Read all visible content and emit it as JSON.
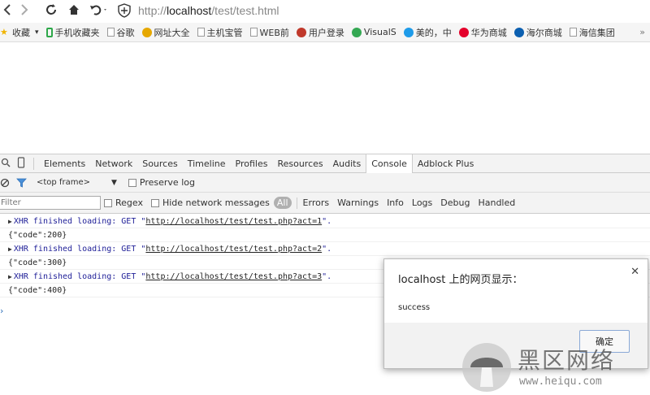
{
  "browser": {
    "url_prefix": "http://",
    "url_host": "localhost",
    "url_path": "/test/test.html"
  },
  "bookmarks": [
    {
      "label": "收藏",
      "icon": "star-icon"
    },
    {
      "label": "手机收藏夹",
      "icon": "phone-icon"
    },
    {
      "label": "谷歌",
      "icon": "page-icon"
    },
    {
      "label": "网址大全",
      "icon": "sogou-icon"
    },
    {
      "label": "主机宝管",
      "icon": "page-icon"
    },
    {
      "label": "WEB前",
      "icon": "page-icon"
    },
    {
      "label": "用户登录",
      "icon": "site-icon"
    },
    {
      "label": "VisualS",
      "icon": "chrome-icon"
    },
    {
      "label": "美的，中",
      "icon": "midea-icon"
    },
    {
      "label": "华为商城",
      "icon": "huawei-icon"
    },
    {
      "label": "海尔商城",
      "icon": "haier-icon"
    },
    {
      "label": "海信集团",
      "icon": "page-icon"
    }
  ],
  "devtools": {
    "tabs": [
      "Elements",
      "Network",
      "Sources",
      "Timeline",
      "Profiles",
      "Resources",
      "Audits",
      "Console",
      "Adblock Plus"
    ],
    "active_tab": "Console",
    "frame_select": "<top frame>",
    "preserve_log": "Preserve log",
    "filter_placeholder": "Filter",
    "regex": "Regex",
    "hide_network": "Hide network messages",
    "levels": [
      "All",
      "Errors",
      "Warnings",
      "Info",
      "Logs",
      "Debug",
      "Handled"
    ]
  },
  "console": {
    "xhr_prefix": "XHR finished loading: GET \"",
    "xhr_suffix": "\".",
    "entries": [
      {
        "url": "http://localhost/test/test.php?act=1",
        "result": "{\"code\":200}"
      },
      {
        "url": "http://localhost/test/test.php?act=2",
        "result": "{\"code\":300}"
      },
      {
        "url": "http://localhost/test/test.php?act=3",
        "result": "{\"code\":400}"
      }
    ]
  },
  "dialog": {
    "title": "localhost 上的网页显示：",
    "message": "success",
    "ok_label": "确定"
  },
  "watermark": {
    "brand": "黑区网络",
    "site": "www.heiqu.com"
  },
  "colors": {
    "xhr_blue": "#222299",
    "all_badge": "#b0b0b0",
    "ok_border": "#8aa9d6"
  }
}
